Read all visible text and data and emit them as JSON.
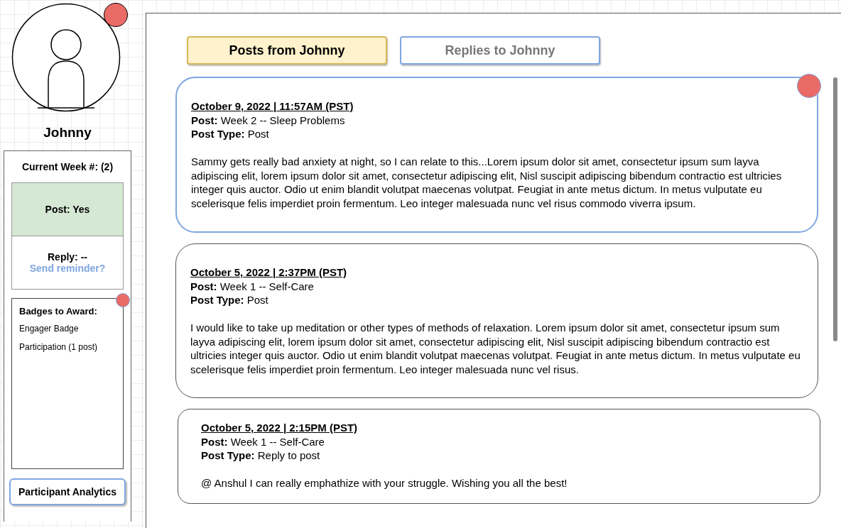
{
  "profile": {
    "name": "Johnny",
    "notification": true
  },
  "week": {
    "title": "Current Week #: (2)",
    "statuses": [
      {
        "text": "Post: Yes",
        "done": true
      },
      {
        "text": "Reply: --",
        "done": false,
        "link": "Send reminder?"
      }
    ]
  },
  "badges": {
    "title": "Badges to Award:",
    "notification": true,
    "items": [
      "Engager Badge",
      "Participation (1 post)"
    ]
  },
  "analytics_button": "Participant Analytics",
  "tabs": [
    {
      "label": "Posts from Johnny",
      "selected": true
    },
    {
      "label": "Replies to Johnny",
      "selected": false
    }
  ],
  "posts": [
    {
      "date": "October 9, 2022 | 11:57AM (PST)",
      "post": "**Post:** Week 2 -- Sleep Problems",
      "type": "**Post Type:** Post",
      "body": "Sammy gets really bad anxiety at night, so I can relate to this...Lorem ipsum dolor sit amet, consectetur ipsum sum layva adipiscing elit, lorem ipsum dolor sit amet, consectetur adipiscing elit, Nisl suscipit adipiscing bibendum contractio est ultricies integer quis auctor. Odio ut enim blandit volutpat maecenas volutpat. Feugiat in ante metus dictum. In metus vulputate eu scelerisque felis imperdiet proin fermentum. Leo integer malesuada nunc vel risus commodo viverra ipsum.",
      "selected": true,
      "notification": true
    },
    {
      "date": "October 5, 2022 | 2:37PM (PST)",
      "post": "**Post:** Week 1 -- Self-Care",
      "type": "**Post Type:** Post",
      "body": "I would like to take up meditation or other types of methods of relaxation. Lorem ipsum dolor sit amet, consectetur ipsum sum layva adipiscing elit, lorem ipsum dolor sit amet, consectetur adipiscing elit, Nisl suscipit adipiscing bibendum contractio est ultricies integer quis auctor. Odio ut enim blandit volutpat maecenas volutpat. Feugiat in ante metus dictum. In metus vulputate eu scelerisque felis imperdiet proin fermentum. Leo integer malesuada nunc vel risus.",
      "selected": false,
      "notification": false
    },
    {
      "date": "October 5, 2022 | 2:15PM (PST)",
      "post": "**Post:** Week 1 -- Self-Care",
      "type": "**Post Type:** Reply to post",
      "body": "@ Anshul I can really emphathize with your struggle. Wishing you all the best!",
      "selected": false,
      "notification": false
    }
  ]
}
